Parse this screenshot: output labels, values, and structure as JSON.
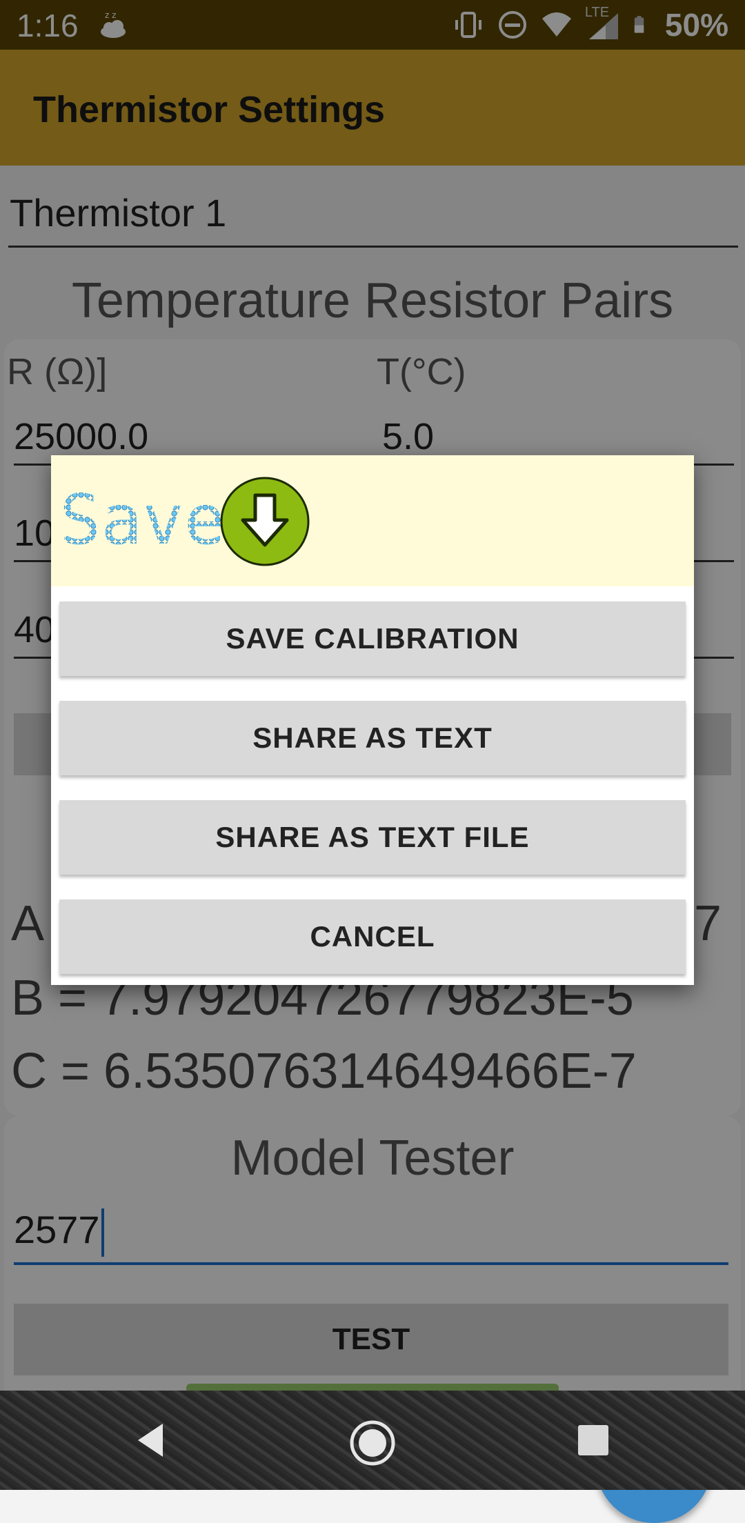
{
  "status_bar": {
    "time": "1:16",
    "network": "LTE",
    "battery": "50%",
    "icons": [
      "sleep-weather-icon",
      "vibrate-icon",
      "do-not-disturb-icon",
      "wifi-icon",
      "signal-icon",
      "battery-icon"
    ]
  },
  "app_bar": {
    "title": "Thermistor Settings"
  },
  "form": {
    "name_value": "Thermistor 1",
    "pairs_title": "Temperature Resistor Pairs",
    "col_r": "R (Ω)]",
    "col_t": "T(°C)",
    "rows": [
      {
        "r": "25000.0",
        "t": "5.0"
      },
      {
        "r": "10",
        "t": ""
      },
      {
        "r": "40",
        "t": ""
      }
    ],
    "coef_a": "A",
    "coef_a_tail": "7",
    "coef_b": "B = 7.979204726779823E-5",
    "coef_c": "C = 6.535076314649466E-7",
    "model_title": "Model Tester",
    "model_input": "2577",
    "test_label": "TEST"
  },
  "fab": {
    "icon": "floppy-disk-icon"
  },
  "dialog": {
    "title_art": "Save",
    "title_icon": "download-arrow-icon",
    "buttons": [
      "SAVE CALIBRATION",
      "SHARE AS TEXT",
      "SHARE AS TEXT FILE",
      "CANCEL"
    ]
  },
  "nav_bar": {
    "icons": [
      "back-icon",
      "home-icon",
      "recents-icon"
    ]
  },
  "colors": {
    "status_bar": "#5a4603",
    "app_bar": "#d3a72b",
    "dialog_header": "#fffbd9",
    "dialog_button": "#d9d9d9",
    "fab": "#3b8ac9",
    "accent": "#1c6fd1",
    "save_icon": "#8dbb12"
  }
}
